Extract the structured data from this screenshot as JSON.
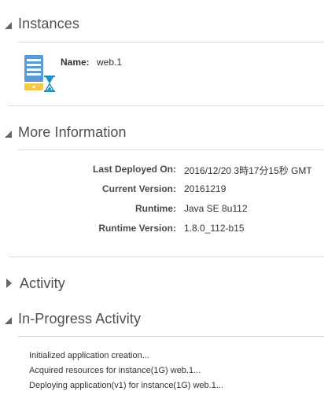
{
  "instances": {
    "title": "Instances",
    "name_label": "Name:",
    "name_value": "web.1"
  },
  "more_information": {
    "title": "More Information",
    "rows": [
      {
        "label": "Last Deployed On:",
        "value": "2016/12/20 3時17分15秒 GMT"
      },
      {
        "label": "Current Version:",
        "value": "20161219"
      },
      {
        "label": "Runtime:",
        "value": "Java SE 8u112"
      },
      {
        "label": "Runtime Version:",
        "value": "1.8.0_112-b15"
      }
    ]
  },
  "activity": {
    "title": "Activity"
  },
  "in_progress": {
    "title": "In-Progress Activity",
    "lines": [
      "Initialized application creation...",
      "Acquired resources for instance(1G) web.1...",
      "Deploying application(v1) for instance(1G) web.1..."
    ]
  },
  "colors": {
    "icon_blue": "#5b9bd5",
    "icon_yellow": "#f2c94c",
    "hourglass": "#1f8fbf"
  },
  "icons": [
    "collapse-triangle-icon",
    "expand-triangle-icon",
    "server-instance-icon",
    "hourglass-icon"
  ]
}
